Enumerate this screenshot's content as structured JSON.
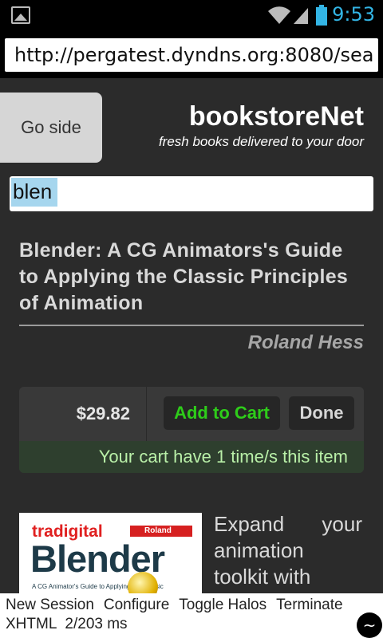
{
  "status_bar": {
    "time": "9:53",
    "icons": [
      "picture-icon",
      "wifi-icon",
      "signal-icon",
      "battery-icon"
    ]
  },
  "browser": {
    "url": "http://pergatest.dyndns.org:8080/sea"
  },
  "header": {
    "go_side_label": "Go side",
    "brand_name": "bookstoreNet",
    "tagline": "fresh books delivered to your door"
  },
  "search": {
    "value": "blen"
  },
  "book": {
    "title": "Blender: A CG Animators's Guide to Applying the Classic Principles of Animation",
    "author": "Roland Hess",
    "price": "$29.82",
    "add_to_cart_label": "Add to Cart",
    "done_label": "Done",
    "cart_status": "Your cart have 1 time/s this item",
    "description": "Expand your animation toolkit with"
  },
  "cover": {
    "brand": "tradigital",
    "author_tag": "Roland Hess",
    "word": "Blender",
    "subtitle": "A CG Animator's Guide to Applying the Classic"
  },
  "footer": {
    "links": [
      "New Session",
      "Configure",
      "Toggle Halos",
      "Terminate"
    ],
    "doc_type": "XHTML",
    "timing": "2/203 ms",
    "menu_glyph": "~"
  },
  "colors": {
    "accent_blue": "#33b5e5",
    "add_green": "#2ecc1a",
    "page_bg": "#2b2b2b"
  }
}
